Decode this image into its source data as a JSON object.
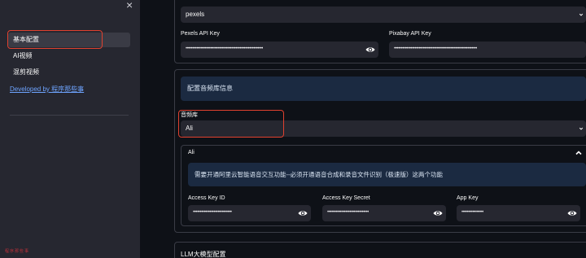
{
  "sidebar": {
    "items": [
      {
        "label": "基本配置"
      },
      {
        "label": "AI视频"
      },
      {
        "label": "混剪视频"
      }
    ],
    "link": "Developed by 程序那些事",
    "watermark": "程序那些事"
  },
  "top": {
    "source_value": "pexels",
    "pexels_label": "Pexels API Key",
    "pexels_value": "••••••••••••••••••••••••••••••••••••••••••••••••••••••••",
    "pixabay_label": "Pixabay API Key",
    "pixabay_value": "••••••••••••••••••••••••••••••••••••••••••••••••••••••••••••"
  },
  "audio": {
    "info": "配置音频库信息",
    "lib_label": "音频库",
    "lib_value": "Ali",
    "expander_title": "Ali",
    "expander_info": "需要开通阿里云智能语音交互功能--必须开通语音合成和录音文件识别（极速版）这两个功能",
    "access_key_id_label": "Access Key ID",
    "access_key_id_value": "••••••••••••••••••••••••••••",
    "access_key_secret_label": "Access Key Secret",
    "access_key_secret_value": "••••••••••••••••••••••••••••••",
    "app_key_label": "App Key",
    "app_key_value": "••••••••••••••••"
  },
  "llm": {
    "title": "LLM大模型配置"
  },
  "colors": {
    "highlight": "#e0412f",
    "link": "#6ea4ff",
    "info_bg": "#1b2a41"
  }
}
